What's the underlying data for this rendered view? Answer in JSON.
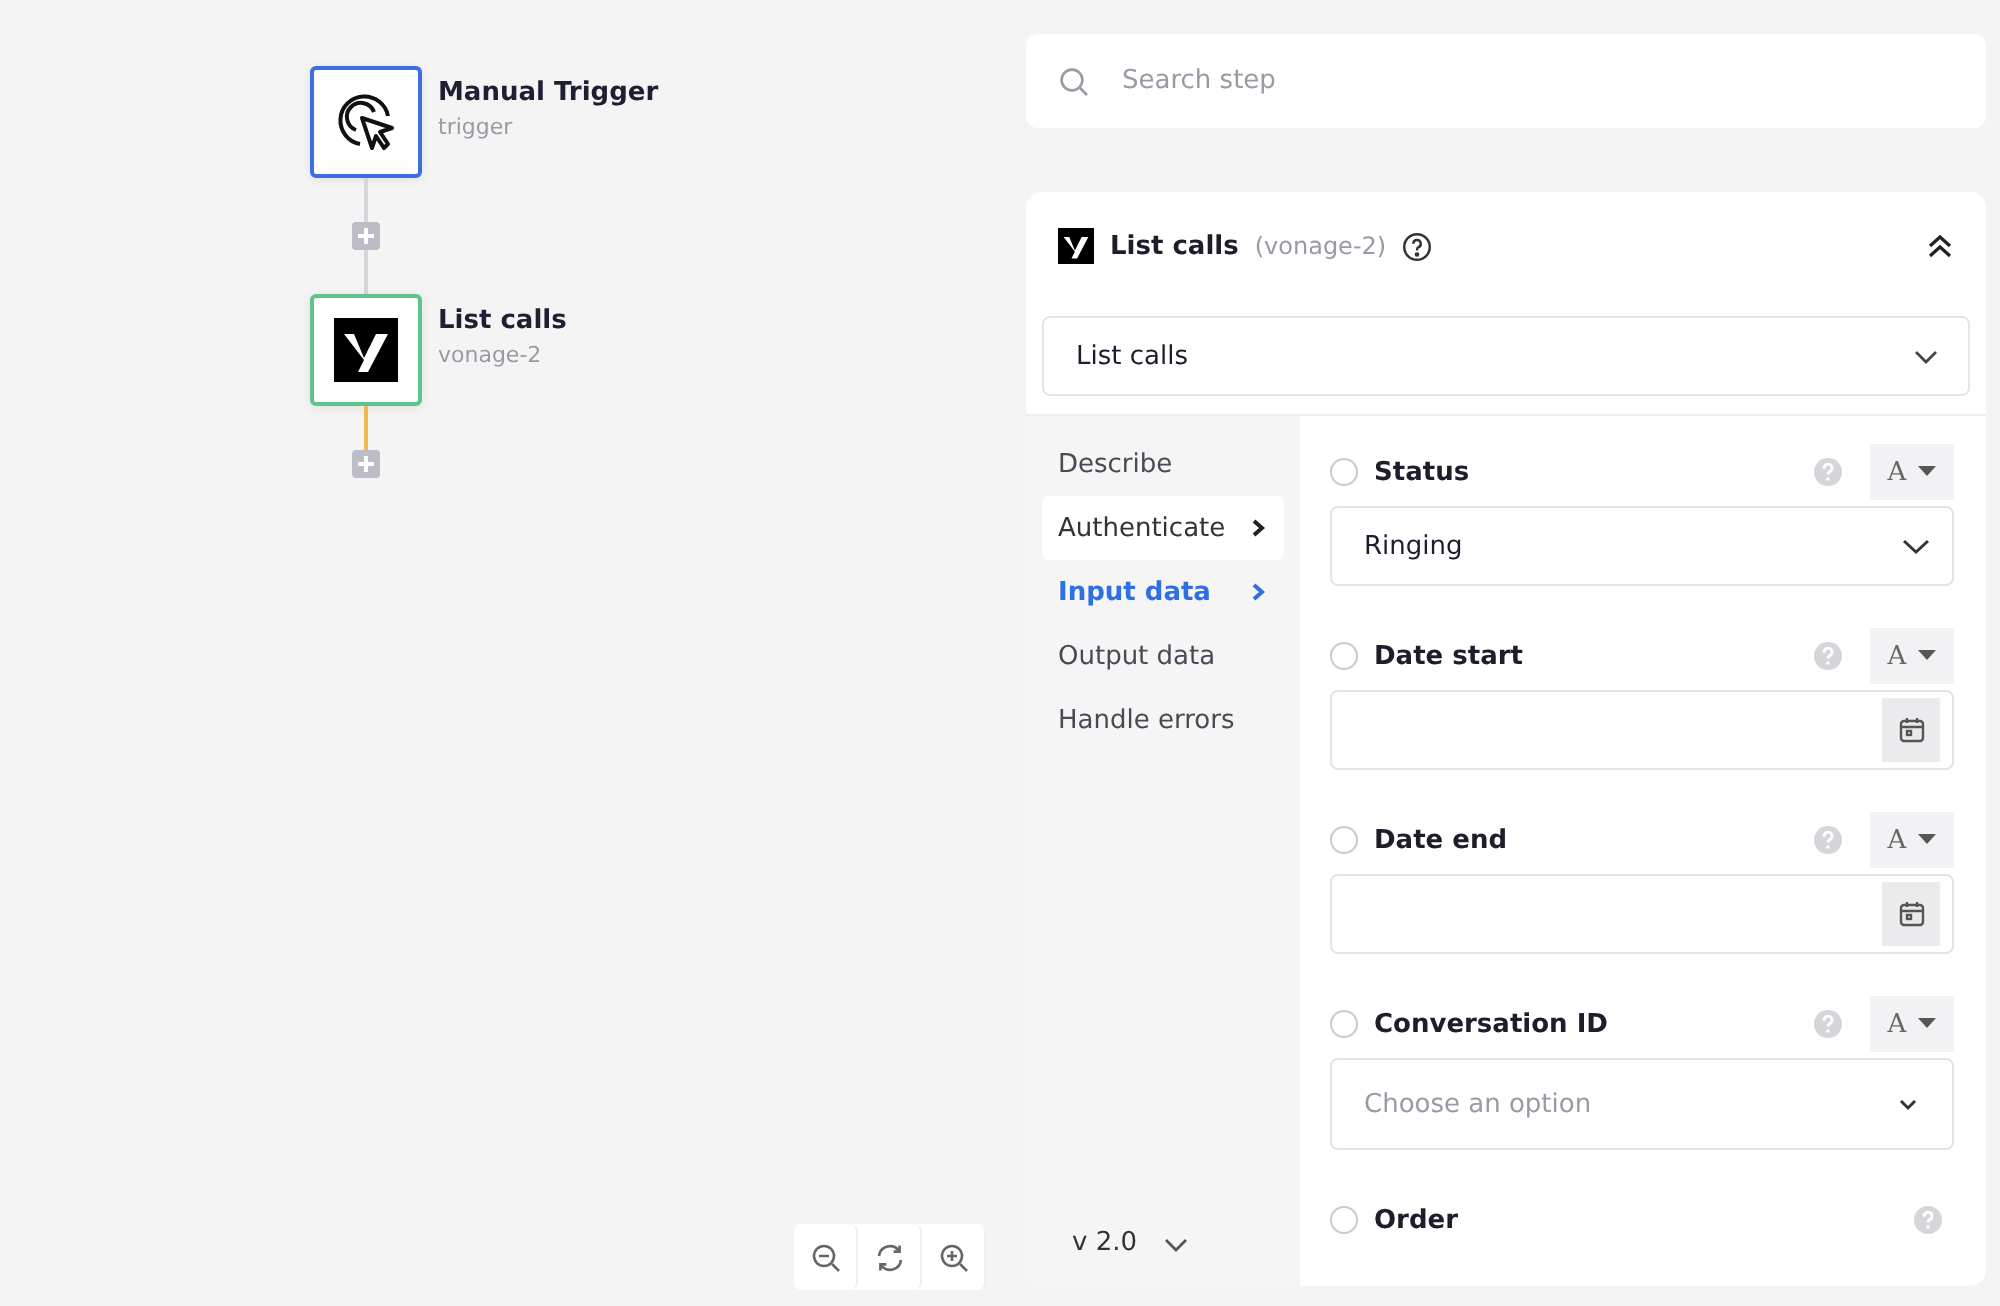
{
  "canvas": {
    "nodes": [
      {
        "title": "Manual Trigger",
        "subtitle": "trigger",
        "kind": "trigger",
        "color": "#3b6fe0"
      },
      {
        "title": "List calls",
        "subtitle": "vonage-2",
        "kind": "action",
        "color": "#5ec48a"
      }
    ],
    "connectors": [
      {
        "color": "#d6d6dc"
      },
      {
        "color": "#f2b84b"
      }
    ]
  },
  "search": {
    "placeholder": "Search step"
  },
  "step": {
    "title": "List calls",
    "app": "(vonage-2)",
    "action": "List calls"
  },
  "nav": [
    {
      "label": "Describe",
      "selected": false,
      "hovered": false,
      "arrow": false
    },
    {
      "label": "Authenticate",
      "selected": false,
      "hovered": true,
      "arrow": true
    },
    {
      "label": "Input data",
      "selected": true,
      "hovered": false,
      "arrow": true
    },
    {
      "label": "Output data",
      "selected": false,
      "hovered": false,
      "arrow": false
    },
    {
      "label": "Handle errors",
      "selected": false,
      "hovered": false,
      "arrow": false
    }
  ],
  "version": "v 2.0",
  "fields": [
    {
      "label": "Status",
      "kind": "select",
      "value": "Ringing",
      "checked": false,
      "mode": "A"
    },
    {
      "label": "Date start",
      "kind": "date",
      "checked": false,
      "mode": "A"
    },
    {
      "label": "Date end",
      "kind": "date",
      "checked": false,
      "mode": "A"
    },
    {
      "label": "Conversation ID",
      "kind": "choice",
      "placeholder": "Choose an option",
      "checked": false,
      "mode": "A"
    },
    {
      "label": "Order",
      "kind": "cut",
      "checked": false
    }
  ]
}
